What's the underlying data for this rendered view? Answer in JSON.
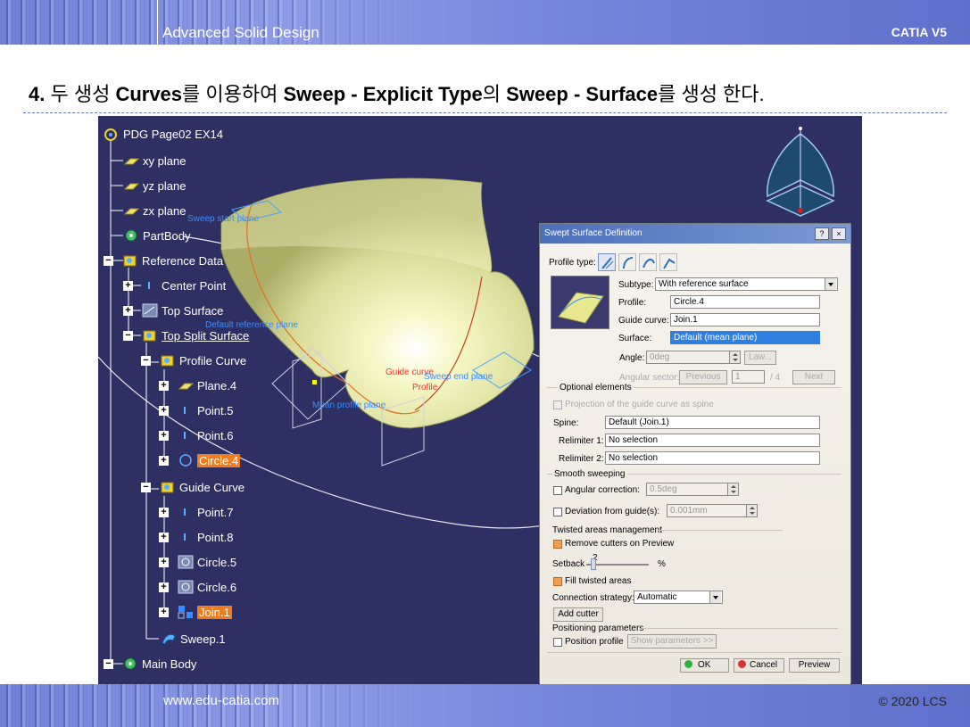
{
  "slide": {
    "header_title": "Advanced Solid Design",
    "header_right": "CATIA V5",
    "footer_left": "www.edu-catia.com",
    "footer_right": "© 2020 LCS",
    "heading_num": "4.",
    "heading_parts": [
      "두 생성 ",
      "Curves",
      "를 이용하여 ",
      "Sweep - Explicit Type",
      "의 ",
      "Sweep - Surface",
      "를 생성 한다."
    ]
  },
  "tree": {
    "root": "PDG Page02 EX14",
    "items": [
      {
        "label": "xy plane"
      },
      {
        "label": "yz plane"
      },
      {
        "label": "zx plane"
      },
      {
        "label": "PartBody"
      },
      {
        "label": "Reference Data"
      },
      {
        "label": "Center Point"
      },
      {
        "label": "Top Surface"
      },
      {
        "label": "Top Split Surface"
      },
      {
        "label": "Profile Curve"
      },
      {
        "label": "Plane.4"
      },
      {
        "label": "Point.5"
      },
      {
        "label": "Point.6"
      },
      {
        "label": "Circle.4"
      },
      {
        "label": "Guide Curve"
      },
      {
        "label": "Point.7"
      },
      {
        "label": "Point.8"
      },
      {
        "label": "Circle.5"
      },
      {
        "label": "Circle.6"
      },
      {
        "label": "Join.1"
      },
      {
        "label": "Sweep.1"
      },
      {
        "label": "Main Body"
      }
    ]
  },
  "scene_labels": {
    "sweep_start_plane": "Sweep start plane",
    "default_reference_plane": "Default reference plane",
    "guide_curve": "Guide curve",
    "profile": "Profile",
    "sweep_end_plane": "Sweep end plane",
    "mean_profile_plane": "Mean profile plane"
  },
  "dialog": {
    "title": "Swept Surface Definition",
    "help_btn": "?",
    "close_btn": "×",
    "profile_type_label": "Profile type:",
    "subtype_label": "Subtype:",
    "subtype_value": "With reference surface",
    "profile_label": "Profile:",
    "profile_value": "Circle.4",
    "guide_label": "Guide curve:",
    "guide_value": "Join.1",
    "surface_label": "Surface:",
    "surface_value": "Default (mean plane)",
    "angle_label": "Angle:",
    "angle_value": "0deg",
    "law_btn": "Law...",
    "angular_sector_label": "Angular sector:",
    "previous_btn": "Previous",
    "sector_value": "1",
    "sector_total": "/ 4",
    "next_btn": "Next",
    "optional_elements": "Optional elements",
    "projection_label": "Projection of the guide curve as spine",
    "spine_label": "Spine:",
    "spine_value": "Default (Join.1)",
    "relimiter1_label": "Relimiter 1:",
    "relimiter1_value": "No selection",
    "relimiter2_label": "Relimiter 2:",
    "relimiter2_value": "No selection",
    "smooth_sweeping": "Smooth sweeping",
    "angular_correction_label": "Angular correction:",
    "angular_correction_value": "0.5deg",
    "deviation_label": "Deviation from guide(s):",
    "deviation_value": "0.001mm",
    "twisted_areas": "Twisted areas management",
    "remove_cutters": "Remove cutters on Preview",
    "setback_label": "Setback",
    "setback_value": "2",
    "setback_unit": "%",
    "fill_twisted": "Fill twisted areas",
    "connection_label": "Connection strategy:",
    "connection_value": "Automatic",
    "add_cutter_btn": "Add cutter",
    "positioning_parameters": "Positioning parameters",
    "position_profile": "Position profile",
    "show_parameters_btn": "Show parameters >>",
    "ok_btn": "OK",
    "cancel_btn": "Cancel",
    "preview_btn": "Preview"
  },
  "colors": {
    "viewport_bg": "#2e3064",
    "highlight": "#f07c1a",
    "dialog_title": "#4d6fb9",
    "selected_field": "#2e7fe0"
  }
}
